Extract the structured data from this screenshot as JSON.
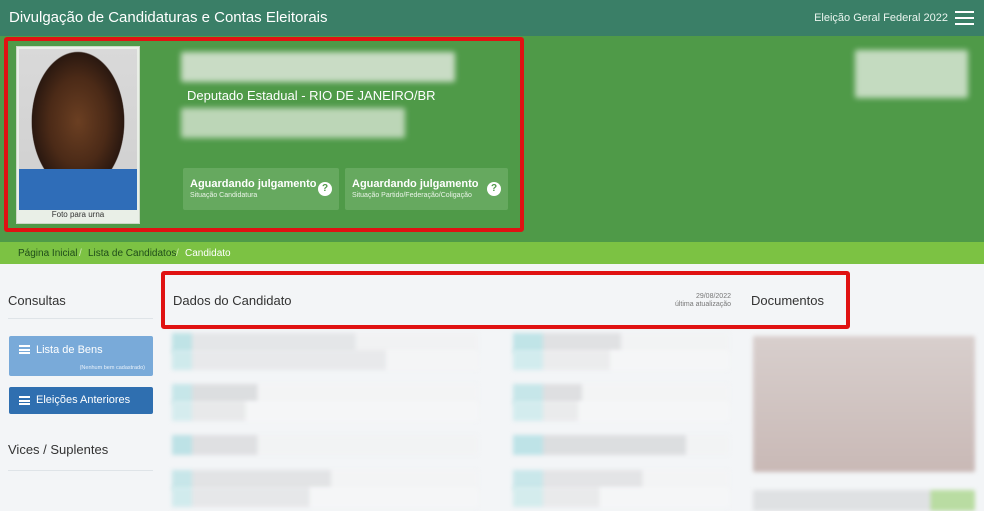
{
  "topbar": {
    "title": "Divulgação de Candidaturas e Contas Eleitorais",
    "election": "Eleição Geral Federal 2022"
  },
  "candidate": {
    "photo_caption": "Foto para urna",
    "role_location": "Deputado Estadual - RIO DE JANEIRO/BR",
    "status_cards": [
      {
        "title": "Aguardando julgamento",
        "subtitle": "Situação Candidatura"
      },
      {
        "title": "Aguardando julgamento",
        "subtitle": "Situação Partido/Federação/Coligação"
      }
    ]
  },
  "breadcrumb": {
    "items": [
      "Página Inicial",
      "Lista de Candidatos",
      "Candidato"
    ],
    "separator": "/"
  },
  "sidebar": {
    "consultas_title": "Consultas",
    "buttons": [
      {
        "label": "Lista de Bens",
        "sub": "(Nenhum bem cadastrado)",
        "color": "#79aad9"
      },
      {
        "label": "Eleições Anteriores",
        "color": "#2f6fb0"
      }
    ],
    "vices_title": "Vices / Suplentes"
  },
  "main": {
    "title": "Dados do Candidato",
    "update_date": "29/08/2022",
    "update_label": "última atualização",
    "documents_title": "Documentos"
  },
  "colors": {
    "topbar": "#3a7f67",
    "hero": "#4f9a48",
    "breadcrumb_bar": "#7cc243",
    "highlight_box": "#e01212"
  }
}
